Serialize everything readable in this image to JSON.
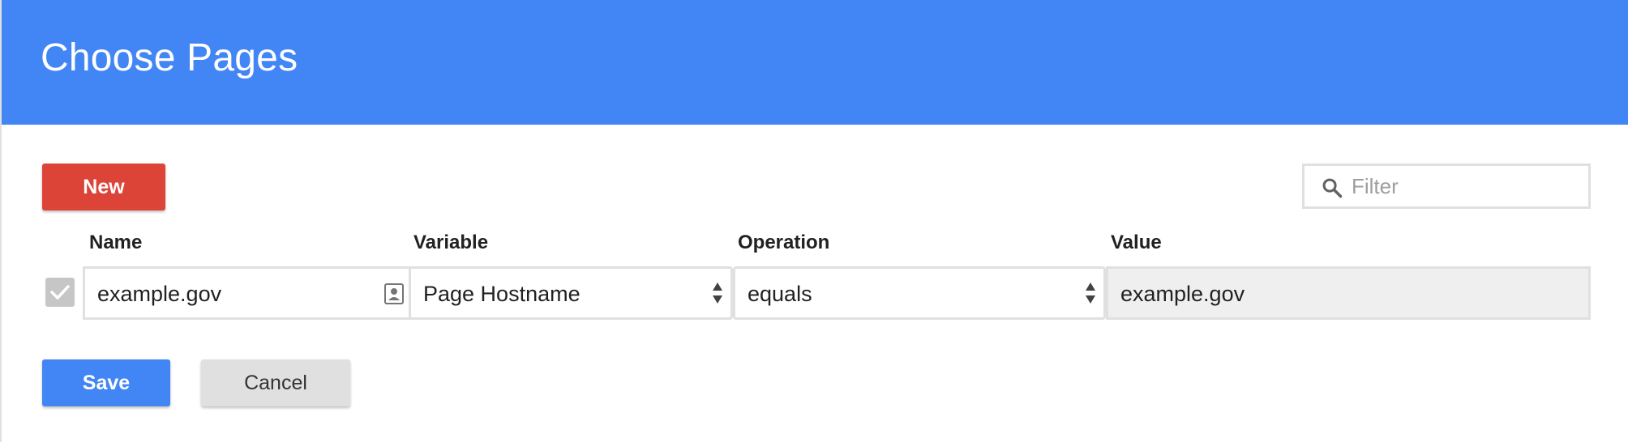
{
  "header": {
    "title": "Choose Pages"
  },
  "toolbar": {
    "new_label": "New"
  },
  "filter": {
    "placeholder": "Filter",
    "value": ""
  },
  "table": {
    "columns": [
      "Name",
      "Variable",
      "Operation",
      "Value"
    ],
    "rows": [
      {
        "checked": true,
        "name": "example.gov",
        "variable": "Page Hostname",
        "operation": "equals",
        "value": "example.gov"
      }
    ]
  },
  "footer": {
    "save_label": "Save",
    "cancel_label": "Cancel"
  },
  "colors": {
    "header_bg": "#4285f4",
    "new_button": "#db4437",
    "save_button": "#4285f4",
    "cancel_button": "#e0e0e0"
  },
  "icons": [
    "search-icon",
    "contact-card-icon",
    "select-arrows-icon",
    "checkmark-icon"
  ]
}
